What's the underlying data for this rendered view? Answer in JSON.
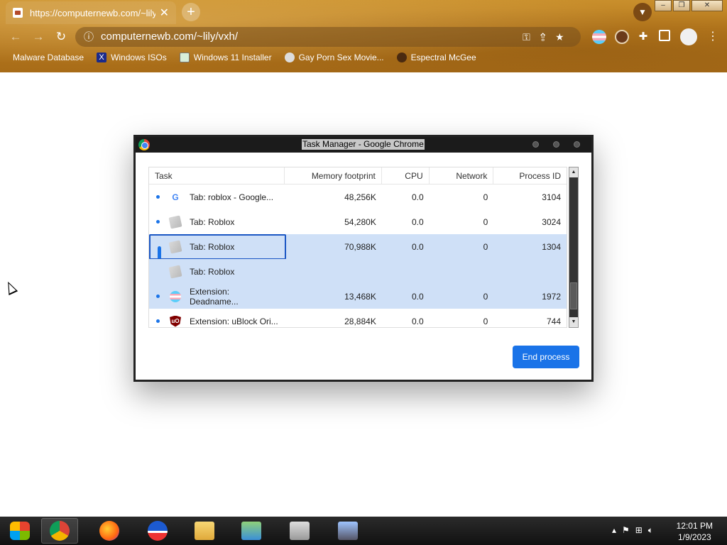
{
  "browser": {
    "tab_title": "https://computernewb.com/~lily/",
    "tab_close": "✕",
    "new_tab": "+",
    "url": "computernewb.com/~lily/vxh/",
    "bookmarks": [
      {
        "label": "Malware Database"
      },
      {
        "label": "Windows ISOs"
      },
      {
        "label": "Windows 11 Installer"
      },
      {
        "label": "Gay Porn Sex Movie..."
      },
      {
        "label": "Espectral McGee"
      }
    ],
    "window_buttons": {
      "minimize": "–",
      "restore": "❐",
      "close": "✕"
    }
  },
  "task_manager": {
    "title": "Task Manager - Google Chrome",
    "columns": [
      "Task",
      "Memory footprint",
      "CPU",
      "Network",
      "Process ID"
    ],
    "rows": [
      {
        "task": "Tab: roblox - Google...",
        "memory": "48,256K",
        "cpu": "0.0",
        "network": "0",
        "pid": "3104"
      },
      {
        "task": "Tab: Roblox",
        "memory": "54,280K",
        "cpu": "0.0",
        "network": "0",
        "pid": "3024"
      },
      {
        "task": "Tab: Roblox",
        "memory": "70,988K",
        "cpu": "0.0",
        "network": "0",
        "pid": "1304"
      },
      {
        "task": "Tab: Roblox",
        "memory": "",
        "cpu": "",
        "network": "",
        "pid": ""
      },
      {
        "task": "Extension: Deadname...",
        "memory": "13,468K",
        "cpu": "0.0",
        "network": "0",
        "pid": "1972"
      },
      {
        "task": "Extension: uBlock Ori...",
        "memory": "28,884K",
        "cpu": "0.0",
        "network": "0",
        "pid": "744"
      }
    ],
    "end_process_label": "End process"
  },
  "taskbar": {
    "time": "12:01 PM",
    "date": "1/9/2023"
  },
  "colors": {
    "accent": "#1a73e8",
    "selection": "#cfe0f7"
  }
}
